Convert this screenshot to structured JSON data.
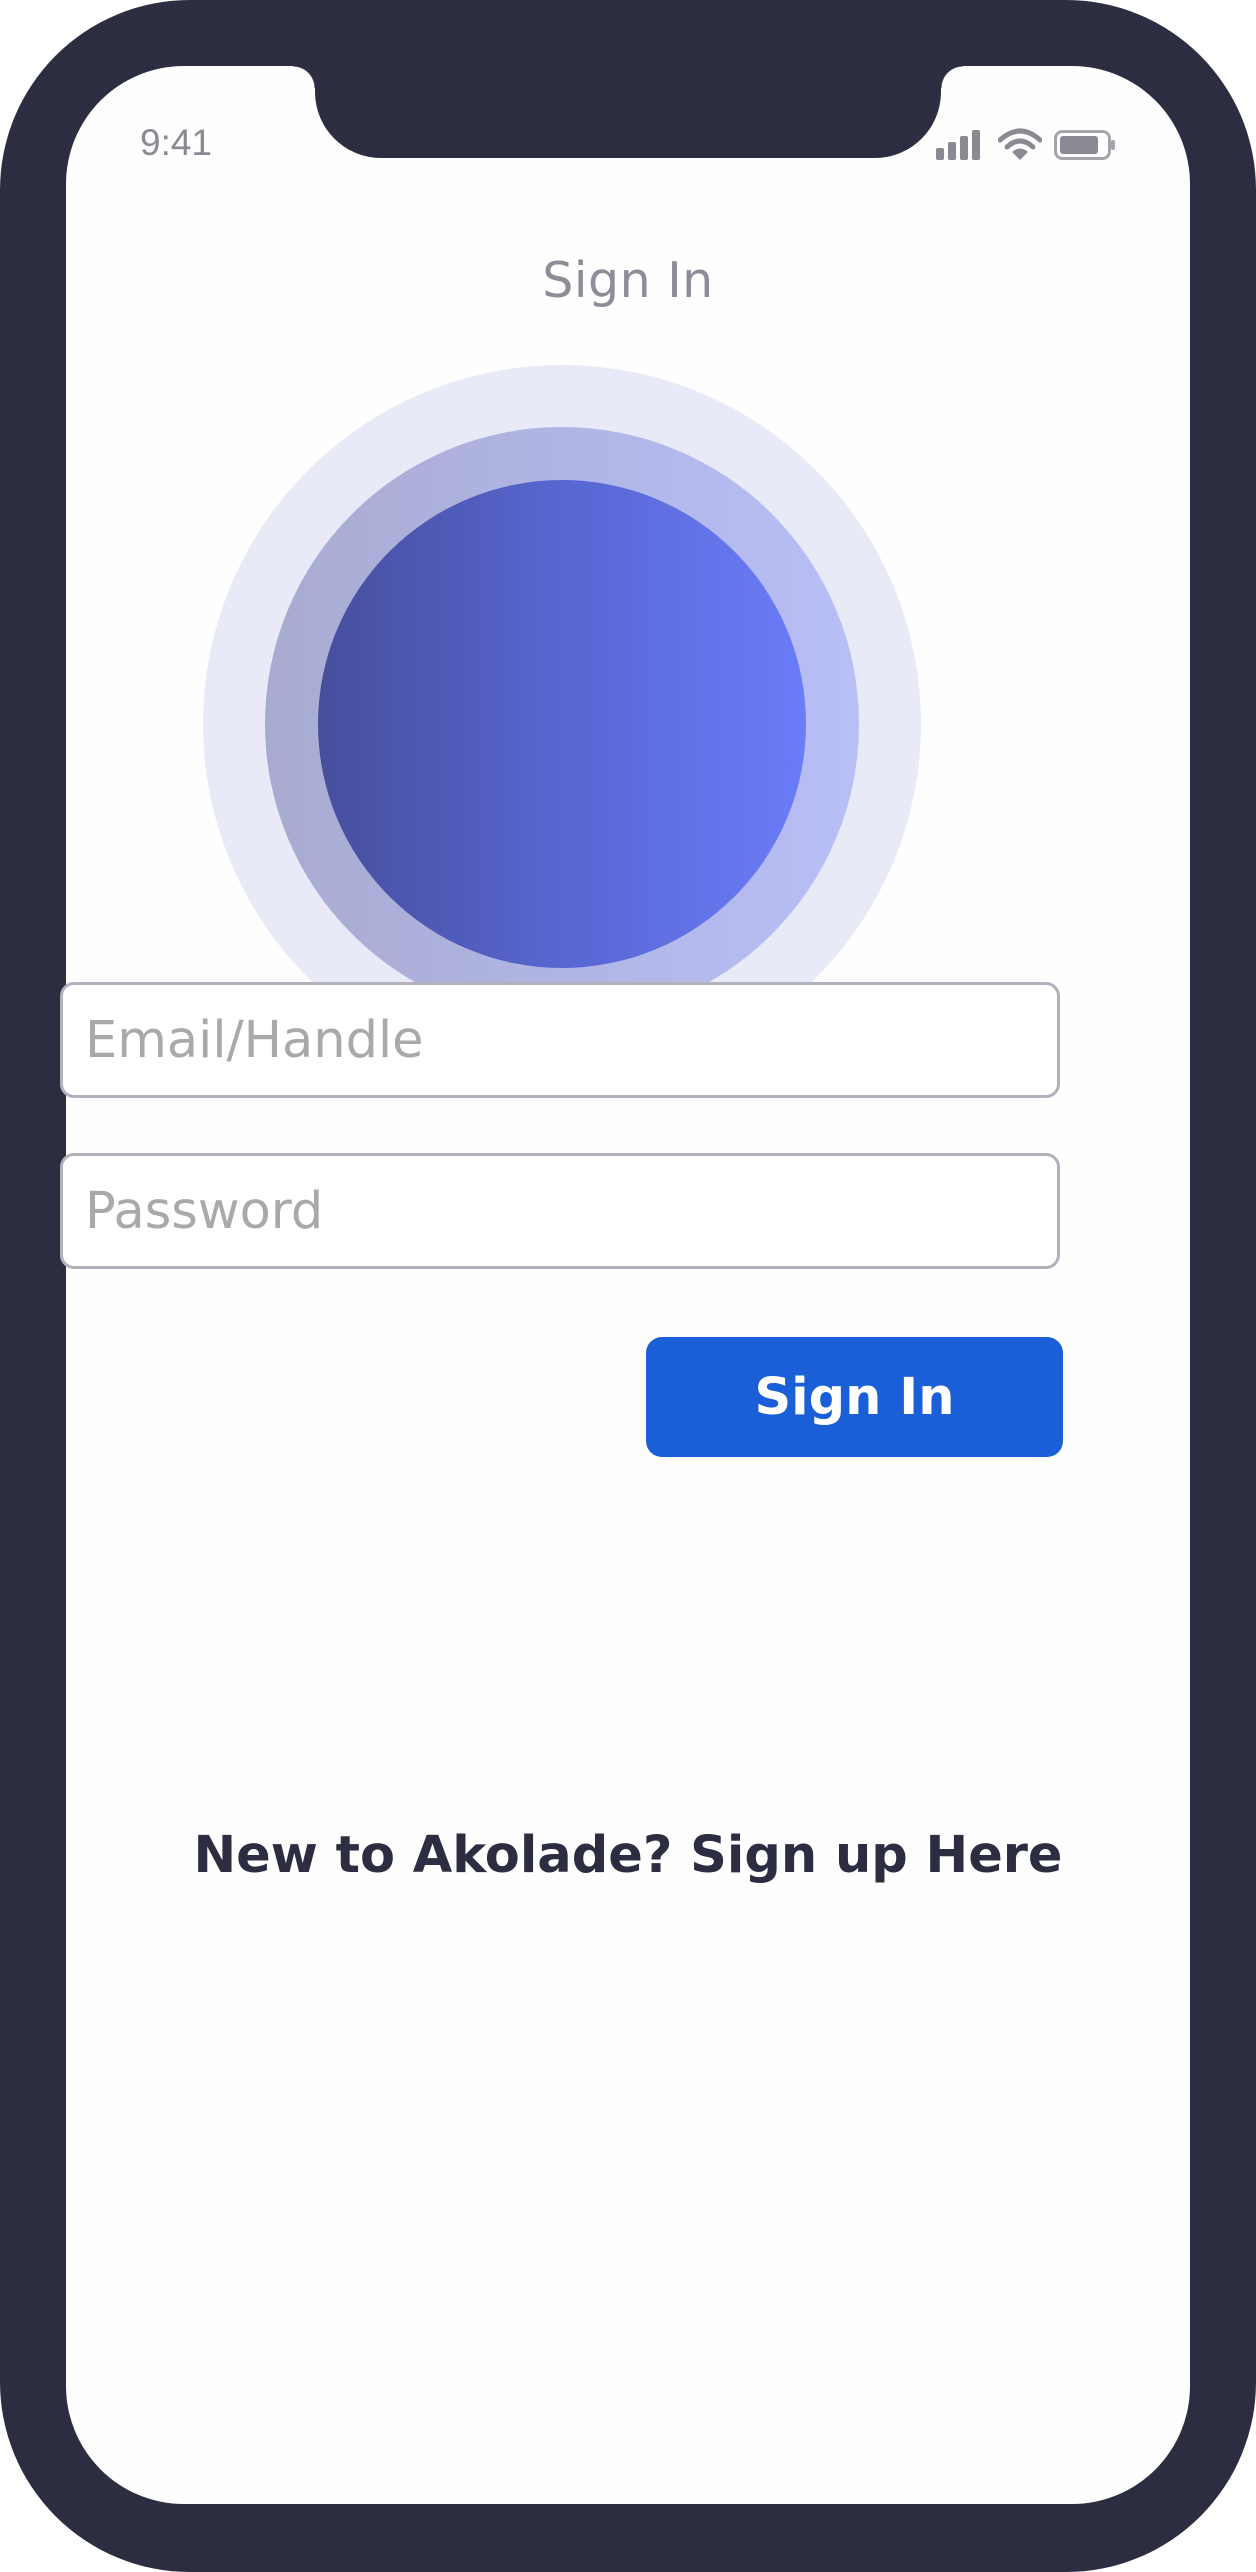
{
  "status_bar": {
    "time": "9:41",
    "icons": [
      "signal-icon",
      "wifi-icon",
      "battery-icon"
    ]
  },
  "header": {
    "title": "Sign In"
  },
  "form": {
    "email_placeholder": "Email/Handle",
    "email_value": "",
    "password_placeholder": "Password",
    "password_value": "",
    "submit_label": "Sign In"
  },
  "footer": {
    "signup_text": "New to Akolade? Sign up Here"
  },
  "colors": {
    "frame": "#2c2d40",
    "primary_button": "#1a5fd8",
    "title_text": "#8d8d98",
    "input_border": "#b3b1bd",
    "placeholder": "#a9a9ab",
    "hero_outer": "#e8eaf7",
    "hero_gradient_start": "#454f9c",
    "hero_gradient_end": "#6a7cf8"
  }
}
